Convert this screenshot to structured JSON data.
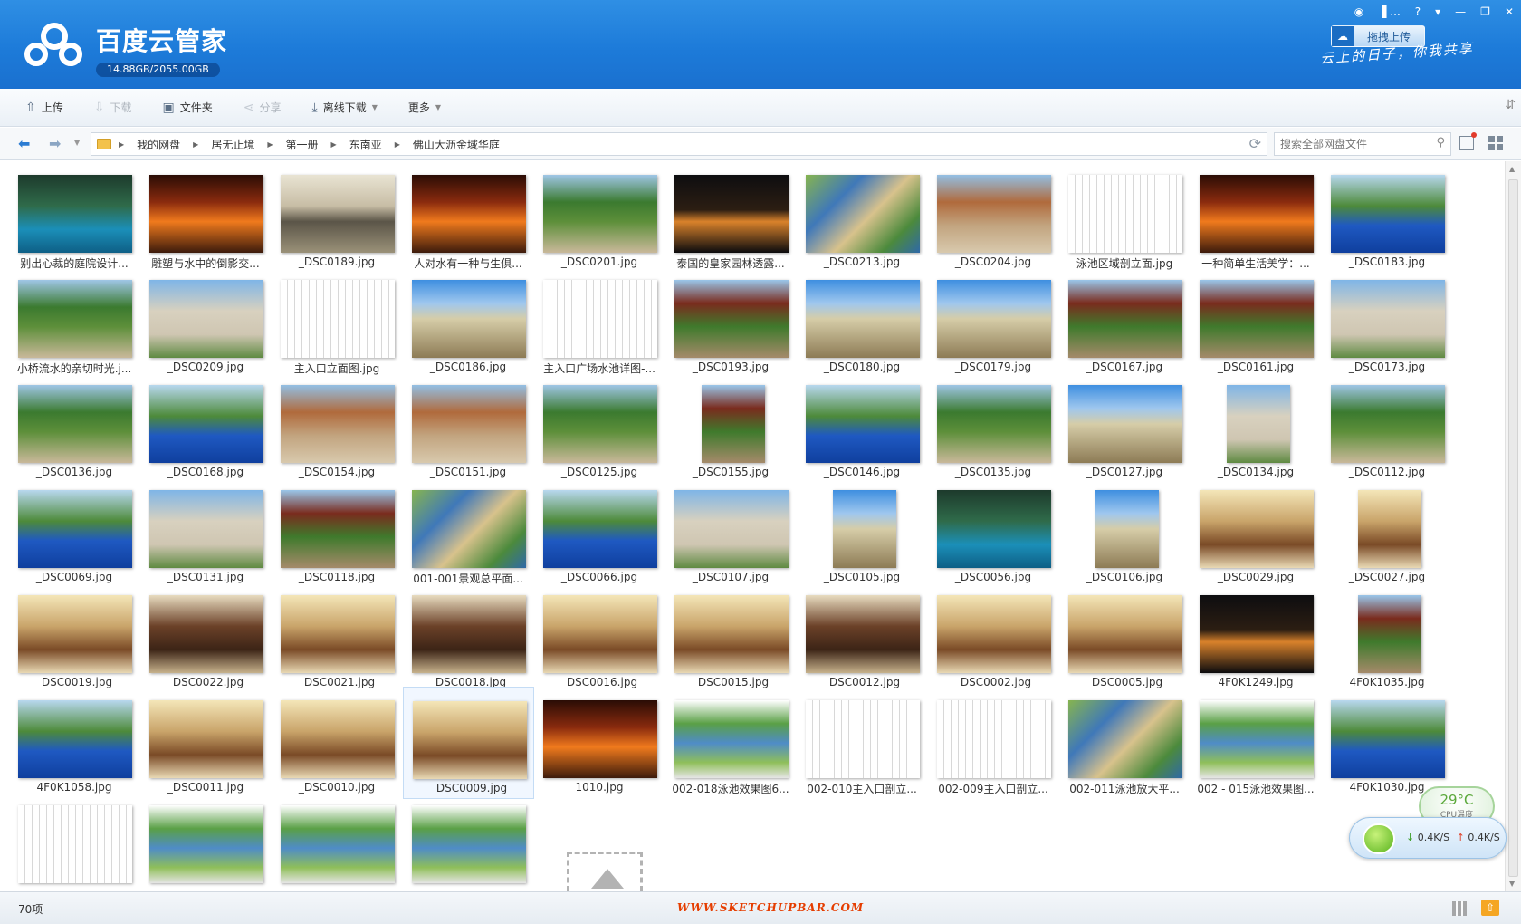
{
  "app": {
    "title": "百度云管家",
    "quota": "14.88GB/2055.00GB",
    "upload_drag_label": "拖拽上传",
    "slogan": "云上的日子，你我共享",
    "window_buttons": [
      "▐ ...",
      "?",
      "▾",
      "—",
      "❐",
      "✕"
    ]
  },
  "toolbar": {
    "upload": "上传",
    "download": "下载",
    "folder": "文件夹",
    "share": "分享",
    "offline_download": "离线下载",
    "more": "更多"
  },
  "nav": {
    "breadcrumbs": [
      "我的网盘",
      "居无止境",
      "第一册",
      "东南亚",
      "佛山大沥金域华庭"
    ],
    "search_placeholder": "搜索全部网盘文件"
  },
  "files": [
    {
      "name": "别出心裁的庭院设计...",
      "scene": "pool-night"
    },
    {
      "name": "雕塑与水中的倒影交...",
      "scene": "lights-red"
    },
    {
      "name": "_DSC0189.jpg",
      "scene": "gate"
    },
    {
      "name": "人对水有一种与生俱...",
      "scene": "lights-red"
    },
    {
      "name": "_DSC0201.jpg",
      "scene": "path-green"
    },
    {
      "name": "泰国的皇家园林透露...",
      "scene": "night"
    },
    {
      "name": "_DSC0213.jpg",
      "scene": "aerial"
    },
    {
      "name": "_DSC0204.jpg",
      "scene": "wall"
    },
    {
      "name": "泳池区域剖立面.jpg",
      "scene": "drawing"
    },
    {
      "name": "一种简单生活美学：...",
      "scene": "lights-red"
    },
    {
      "name": "_DSC0183.jpg",
      "scene": "pool-blue"
    },
    {
      "name": "小桥流水的亲切时光.j...",
      "scene": "path-green"
    },
    {
      "name": "_DSC0209.jpg",
      "scene": "building"
    },
    {
      "name": "主入口立面图.jpg",
      "scene": "drawing"
    },
    {
      "name": "_DSC0186.jpg",
      "scene": "tower"
    },
    {
      "name": "主入口广场水池详图-...",
      "scene": "drawing"
    },
    {
      "name": "_DSC0193.jpg",
      "scene": "pavilion"
    },
    {
      "name": "_DSC0180.jpg",
      "scene": "tower"
    },
    {
      "name": "_DSC0179.jpg",
      "scene": "tower"
    },
    {
      "name": "_DSC0167.jpg",
      "scene": "pavilion"
    },
    {
      "name": "_DSC0161.jpg",
      "scene": "pavilion"
    },
    {
      "name": "_DSC0173.jpg",
      "scene": "building"
    },
    {
      "name": "_DSC0136.jpg",
      "scene": "path-green"
    },
    {
      "name": "_DSC0168.jpg",
      "scene": "pool-blue"
    },
    {
      "name": "_DSC0154.jpg",
      "scene": "wall"
    },
    {
      "name": "_DSC0151.jpg",
      "scene": "wall"
    },
    {
      "name": "_DSC0125.jpg",
      "scene": "path-green"
    },
    {
      "name": "_DSC0155.jpg",
      "scene": "pavilion",
      "portrait": true
    },
    {
      "name": "_DSC0146.jpg",
      "scene": "pool-blue"
    },
    {
      "name": "_DSC0135.jpg",
      "scene": "path-green"
    },
    {
      "name": "_DSC0127.jpg",
      "scene": "tower"
    },
    {
      "name": "_DSC0134.jpg",
      "scene": "building",
      "portrait": true
    },
    {
      "name": "_DSC0112.jpg",
      "scene": "path-green"
    },
    {
      "name": "_DSC0069.jpg",
      "scene": "pool-blue"
    },
    {
      "name": "_DSC0131.jpg",
      "scene": "building"
    },
    {
      "name": "_DSC0118.jpg",
      "scene": "pavilion"
    },
    {
      "name": "001-001景观总平面...",
      "scene": "aerial"
    },
    {
      "name": "_DSC0066.jpg",
      "scene": "pool-blue"
    },
    {
      "name": "_DSC0107.jpg",
      "scene": "building"
    },
    {
      "name": "_DSC0105.jpg",
      "scene": "tower",
      "portrait": true
    },
    {
      "name": "_DSC0056.jpg",
      "scene": "pool-night"
    },
    {
      "name": "_DSC0106.jpg",
      "scene": "tower",
      "portrait": true
    },
    {
      "name": "_DSC0029.jpg",
      "scene": "interior"
    },
    {
      "name": "_DSC0027.jpg",
      "scene": "interior",
      "portrait": true
    },
    {
      "name": "_DSC0019.jpg",
      "scene": "interior"
    },
    {
      "name": "_DSC0022.jpg",
      "scene": "interior-dark"
    },
    {
      "name": "_DSC0021.jpg",
      "scene": "interior"
    },
    {
      "name": "_DSC0018.jpg",
      "scene": "interior-dark"
    },
    {
      "name": "_DSC0016.jpg",
      "scene": "interior"
    },
    {
      "name": "_DSC0015.jpg",
      "scene": "interior"
    },
    {
      "name": "_DSC0012.jpg",
      "scene": "interior-dark"
    },
    {
      "name": "_DSC0002.jpg",
      "scene": "interior"
    },
    {
      "name": "_DSC0005.jpg",
      "scene": "interior"
    },
    {
      "name": "4F0K1249.jpg",
      "scene": "night"
    },
    {
      "name": "4F0K1035.jpg",
      "scene": "pavilion",
      "portrait": true
    },
    {
      "name": "4F0K1058.jpg",
      "scene": "pool-blue"
    },
    {
      "name": "_DSC0011.jpg",
      "scene": "interior"
    },
    {
      "name": "_DSC0010.jpg",
      "scene": "interior"
    },
    {
      "name": "_DSC0009.jpg",
      "scene": "interior",
      "selected": true
    },
    {
      "name": "1010.jpg",
      "scene": "lights-red"
    },
    {
      "name": "002-018泳池效果图6...",
      "scene": "render"
    },
    {
      "name": "002-010主入口剖立...",
      "scene": "drawing"
    },
    {
      "name": "002-009主入口剖立...",
      "scene": "drawing"
    },
    {
      "name": "002-011泳池放大平...",
      "scene": "aerial"
    },
    {
      "name": "002 - 015泳池效果图...",
      "scene": "render"
    },
    {
      "name": "4F0K1030.jpg",
      "scene": "pool-blue"
    },
    {
      "name": "",
      "scene": "drawing"
    },
    {
      "name": "",
      "scene": "render"
    },
    {
      "name": "",
      "scene": "render"
    },
    {
      "name": "",
      "scene": "render"
    }
  ],
  "status": {
    "count": "70项",
    "watermark": "WWW.SKETCHUPBAR.COM"
  },
  "widget": {
    "temp": "29°C",
    "temp_label": "CPU温度",
    "down": "0.4K/S",
    "up": "0.4K/S"
  },
  "colors": {
    "header": "#1d7bd9",
    "accent": "#2b7cd3",
    "watermark": "#e53d00"
  }
}
